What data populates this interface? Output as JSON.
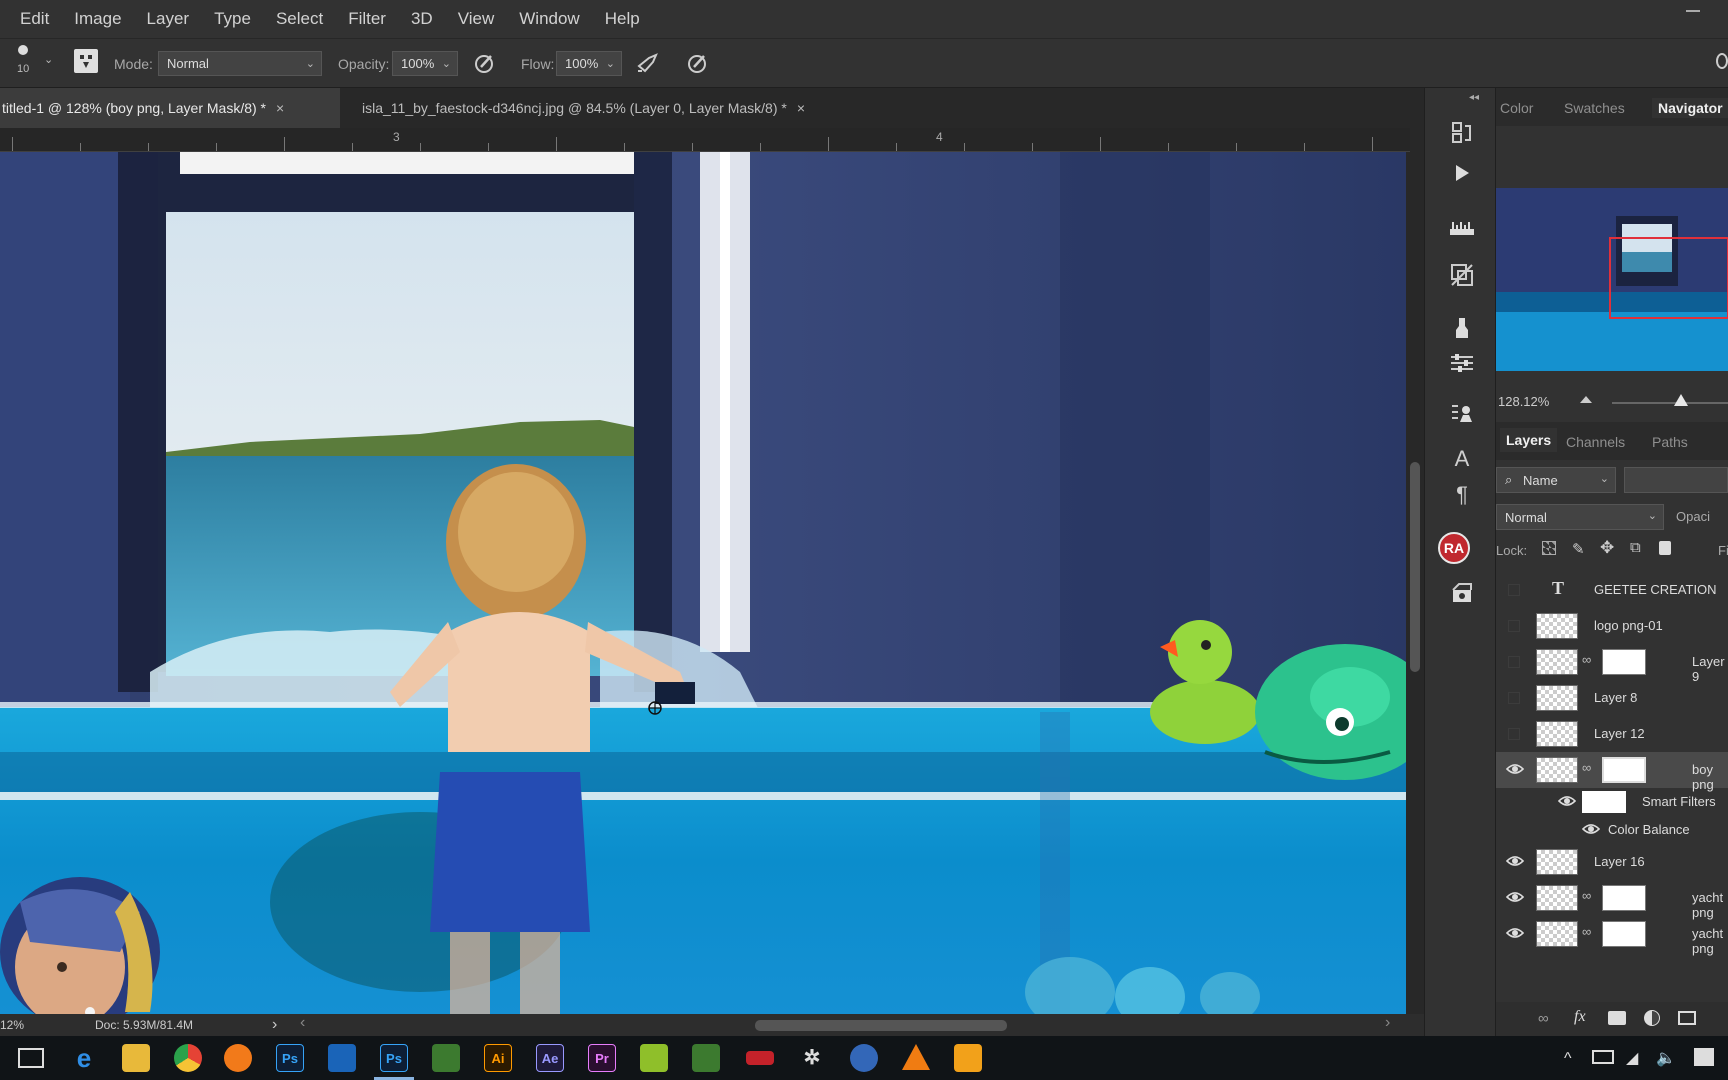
{
  "menu": [
    "Edit",
    "Image",
    "Layer",
    "Type",
    "Select",
    "Filter",
    "3D",
    "View",
    "Window",
    "Help"
  ],
  "options": {
    "brush_size": "10",
    "mode_label": "Mode:",
    "mode_value": "Normal",
    "opacity_label": "Opacity:",
    "opacity_value": "100%",
    "flow_label": "Flow:",
    "flow_value": "100%"
  },
  "tabs": [
    {
      "label": "titled-1 @ 128% (boy png, Layer Mask/8) *",
      "close": "×"
    },
    {
      "label": "isla_11_by_faestock-d346ncj.jpg @ 84.5% (Layer 0, Layer Mask/8) *",
      "close": "×"
    }
  ],
  "ruler": {
    "labels": [
      "3",
      "4"
    ]
  },
  "status": {
    "zoom": "12%",
    "doc": "Doc: 5.93M/81.4M",
    "arrow": "›",
    "left_arrow": "‹",
    "right_arrow": "›"
  },
  "toolstrip": {
    "ra_badge": "RA",
    "text_tool": "A",
    "para_tool": "¶"
  },
  "panels": {
    "top_tabs": [
      "Color",
      "Swatches",
      "Navigator"
    ],
    "navigator_zoom": "128.12%",
    "layer_tabs": [
      "Layers",
      "Channels",
      "Paths"
    ],
    "filter_kind": "Name",
    "blend_mode": "Normal",
    "opacity_label": "Opaci",
    "lock_label": "Lock:",
    "fill_label": "Fi",
    "layers": [
      {
        "name": "GEETEE CREATION",
        "type": "text",
        "visible": false
      },
      {
        "name": "logo png-01",
        "type": "smart",
        "visible": false
      },
      {
        "name": "Layer 9",
        "type": "mask",
        "visible": false
      },
      {
        "name": "Layer 8",
        "type": "plain",
        "visible": false
      },
      {
        "name": "Layer 12",
        "type": "plain",
        "visible": false
      },
      {
        "name": "boy png",
        "type": "smart-mask",
        "visible": true,
        "selected": true
      },
      {
        "name": "Smart Filters",
        "type": "sub",
        "visible": true
      },
      {
        "name": "Color Balance",
        "type": "sub2",
        "visible": true
      },
      {
        "name": "Layer 16",
        "type": "plain",
        "visible": true
      },
      {
        "name": "yacht png",
        "type": "smart-mask",
        "visible": true
      },
      {
        "name": "yacht png",
        "type": "smart-mask",
        "visible": true
      }
    ]
  },
  "taskbar": {
    "apps": [
      "Ps",
      "Ps",
      "Ai",
      "Ae",
      "Pr"
    ]
  },
  "colors": {
    "accent_red": "#c0282e",
    "taskbar": "#101417",
    "panel": "#323232"
  }
}
